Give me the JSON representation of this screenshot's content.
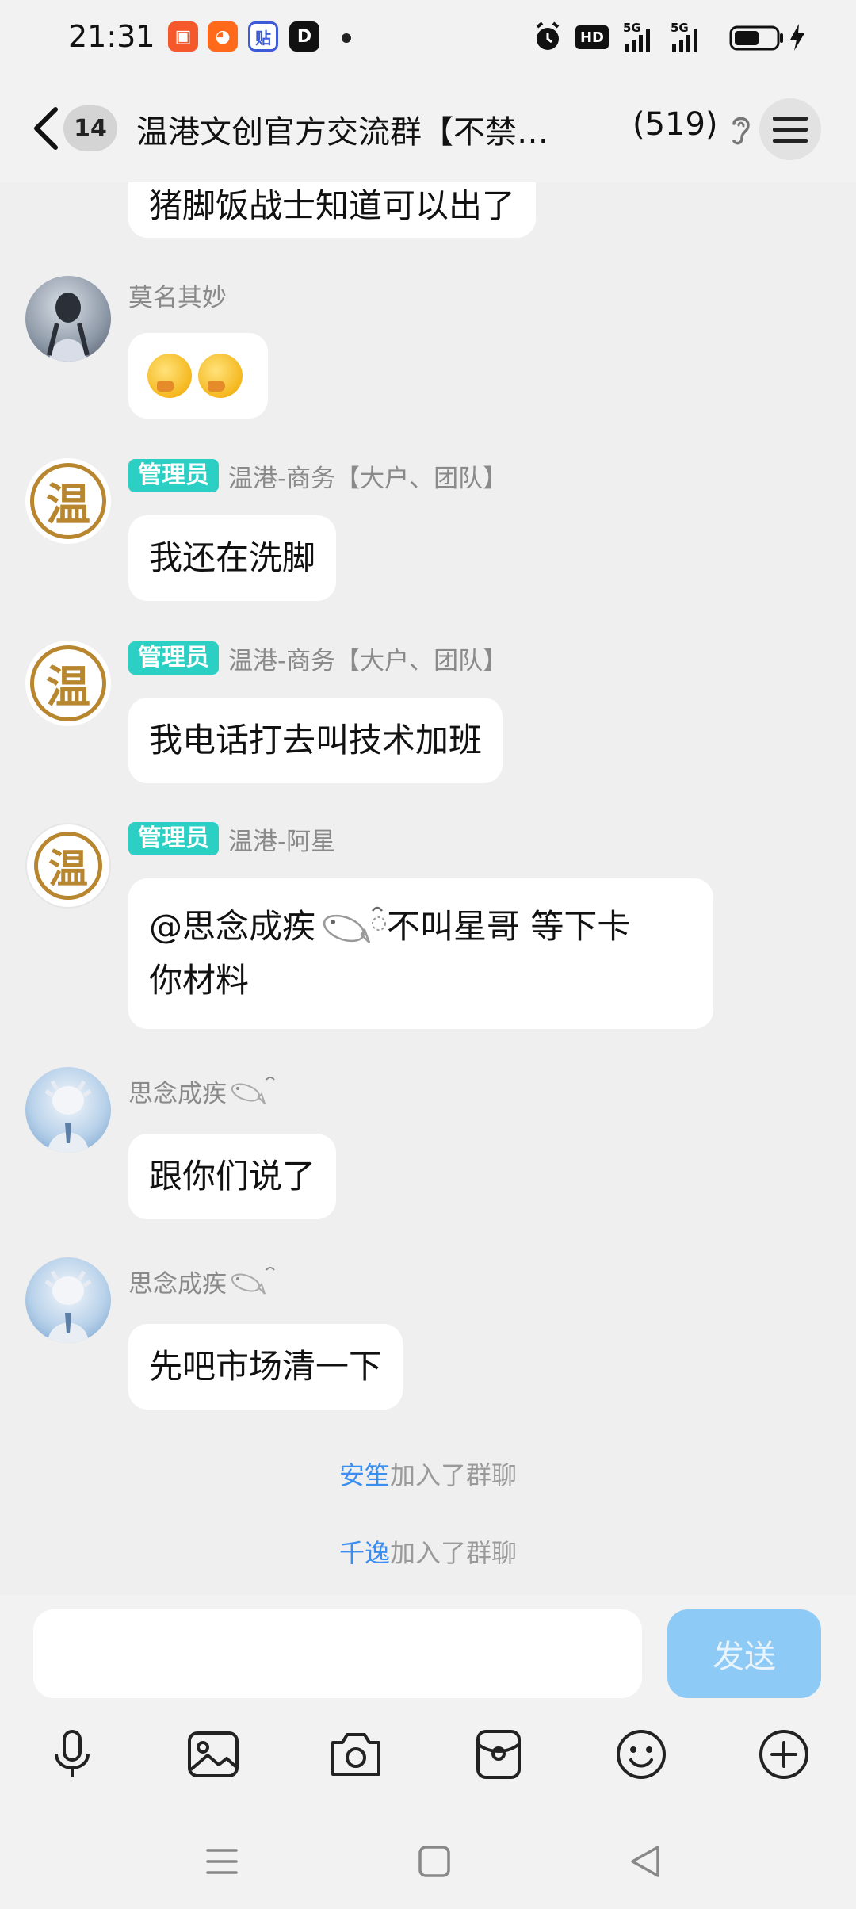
{
  "status_bar": {
    "time": "21:31",
    "app_icons": [
      {
        "name": "kuaishou-icon",
        "color": "#f4582b",
        "glyph": "▣"
      },
      {
        "name": "taobao-icon",
        "color": "#ff6a1a",
        "glyph": "◕"
      },
      {
        "name": "tieba-icon",
        "color": "#3d5bd8",
        "glyph": "贴"
      },
      {
        "name": "zhihu-icon",
        "color": "#111111",
        "glyph": "D"
      }
    ],
    "network_label": "HD",
    "net1": "5G",
    "net2": "5G"
  },
  "header": {
    "unread_count": "14",
    "group_title": "温港文创官方交流群【不禁…",
    "member_count": "(519)"
  },
  "messages": [
    {
      "text": "猪脚饭战士知道可以出了"
    },
    {
      "sender": "莫名其妙",
      "emoji": [
        "hand-over-mouth-emoji",
        "hand-over-mouth-emoji"
      ]
    },
    {
      "badge": "管理员",
      "sender": "温港-商务【大户、团队】",
      "text": "我还在洗脚"
    },
    {
      "badge": "管理员",
      "sender": "温港-商务【大户、团队】",
      "text": "我电话打去叫技术加班"
    },
    {
      "badge": "管理员",
      "sender": "温港-阿星",
      "text": "@思念成疾",
      "text2": " 不叫星哥 等下卡",
      "text3": "你材料"
    },
    {
      "sender": "思念成疾",
      "text": "跟你们说了"
    },
    {
      "sender": "思念成疾",
      "text": "先吧市场清一下"
    }
  ],
  "seal_char": "温",
  "system_messages": [
    {
      "who": "安笙",
      "action": "加入了群聊"
    },
    {
      "who": "千逸",
      "action": "加入了群聊"
    }
  ],
  "input": {
    "placeholder": "",
    "send_label": "发送"
  },
  "colors": {
    "admin_badge": "#2ccfc3",
    "send_button": "#8ecaf6",
    "link_blue": "#3a8ef0",
    "seal_gold": "#b8862e"
  }
}
